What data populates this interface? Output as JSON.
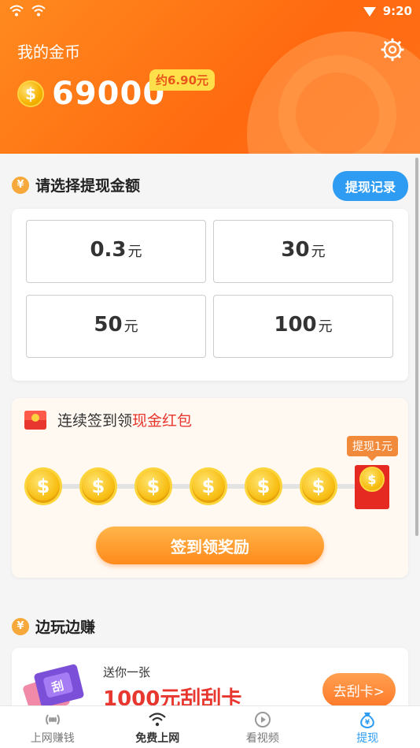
{
  "status_bar": {
    "time": "9:20"
  },
  "header": {
    "title": "我的金币",
    "coin_symbol": "$",
    "coin_amount": "69000",
    "approx_value": "约6.90元"
  },
  "withdraw": {
    "section_icon": "¥",
    "section_title": "请选择提现金额",
    "record_button": "提现记录",
    "options": [
      {
        "amount": "0.3",
        "unit": "元"
      },
      {
        "amount": "30",
        "unit": "元"
      },
      {
        "amount": "50",
        "unit": "元"
      },
      {
        "amount": "100",
        "unit": "元"
      }
    ]
  },
  "signin": {
    "title_prefix": "连续签到领",
    "title_highlight": "现金红包",
    "coin_symbol": "$",
    "reward_tag": "提现1元",
    "button": "签到领奖励"
  },
  "play": {
    "section_icon": "¥",
    "section_title": "边玩边赚",
    "card_badge": "刮",
    "gift_text": "送你一张",
    "scratch_title": "1000元刮刮卡",
    "scratch_button": "去刮卡>"
  },
  "nav": {
    "items": [
      {
        "label": "上网赚钱",
        "icon": "radar-icon"
      },
      {
        "label": "免费上网",
        "icon": "wifi-icon"
      },
      {
        "label": "看视频",
        "icon": "play-icon"
      },
      {
        "label": "提现",
        "icon": "money-bag-icon"
      }
    ],
    "active_index": 3
  },
  "colors": {
    "accent_orange": "#ff7a1a",
    "accent_blue": "#2e9cf2",
    "accent_red": "#e8372e"
  }
}
